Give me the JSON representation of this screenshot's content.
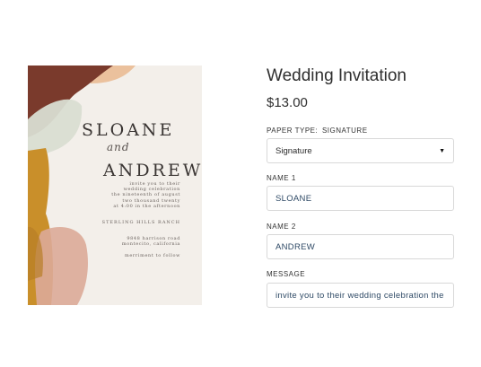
{
  "card": {
    "name1": "SLOANE",
    "and": "and",
    "name2": "ANDREW",
    "invite_lines": [
      "invite you to their",
      "wedding celebration",
      "the nineteenth of august",
      "two thousand twenty",
      "at 4:00 in the afternoon"
    ],
    "venue": "STERLING HILLS RANCH",
    "address_lines": [
      "9848 harrison road",
      "montecito, california"
    ],
    "follow": "merriment to follow",
    "colors": {
      "maroon": "#7a3a2c",
      "peach": "#e9b98f",
      "sage": "#d9ddd2",
      "mustard": "#c98f2a",
      "blush": "#dcaa98",
      "paper": "#f3efea"
    }
  },
  "product": {
    "title": "Wedding Invitation",
    "price": "$13.00"
  },
  "paper_type": {
    "label": "PAPER TYPE:",
    "selected_label": "SIGNATURE",
    "value": "Signature",
    "caret_icon": "caret-down-icon"
  },
  "name1": {
    "label": "NAME 1",
    "value": "SLOANE"
  },
  "name2": {
    "label": "NAME 2",
    "value": "ANDREW"
  },
  "message": {
    "label": "MESSAGE",
    "value": "invite you to their wedding celebration the nineteenth of august"
  }
}
